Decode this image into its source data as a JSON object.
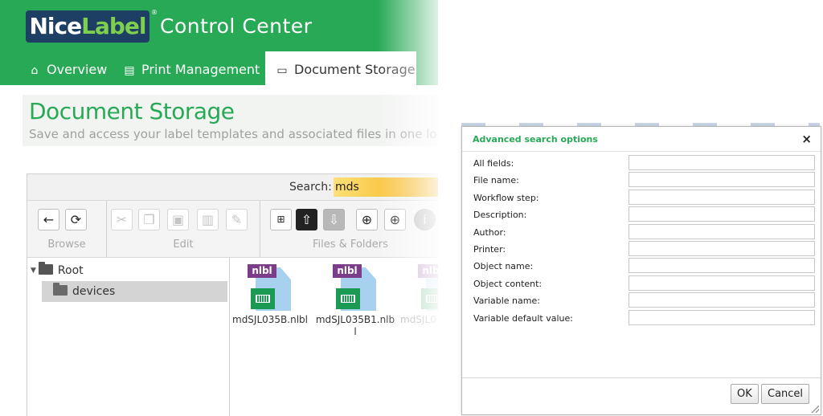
{
  "app": {
    "brand_part1": "Nice",
    "brand_part2": "Label",
    "brand_mark": "®",
    "name": "Control Center",
    "brand_colors": {
      "green": "#27a955",
      "navy": "#1c3f63"
    }
  },
  "nav": {
    "tabs": [
      {
        "label": "Overview",
        "icon": "home-icon"
      },
      {
        "label": "Print Management",
        "icon": "printer-icon"
      },
      {
        "label": "Document Storage",
        "icon": "inbox-icon",
        "active": true
      }
    ]
  },
  "page": {
    "title": "Document Storage",
    "subtitle": "Save and access your label templates and associated files in one lo"
  },
  "search": {
    "label": "Search:",
    "value": "mds"
  },
  "toolbar": {
    "groups": [
      {
        "caption": "Browse",
        "buttons": [
          "back-icon",
          "refresh-icon"
        ]
      },
      {
        "caption": "Edit",
        "buttons": [
          "cut-icon",
          "copy-icon",
          "paste-icon",
          "delete-icon",
          "edit-icon"
        ]
      },
      {
        "caption": "Files & Folders",
        "buttons": [
          "network-icon",
          "upload-icon",
          "download-icon",
          "new-folder-icon",
          "new-file-icon",
          "info-icon"
        ]
      }
    ]
  },
  "tree": {
    "root": "Root",
    "devices": "devices"
  },
  "files": [
    {
      "badge": "nlbl",
      "name": "mdSJL035B.nlbl"
    },
    {
      "badge": "nlbl",
      "name": "mdSJL035B1.nlbl"
    },
    {
      "badge": "nlbl",
      "name": "mdSJL0"
    }
  ],
  "dialog": {
    "title": "Advanced search options",
    "close": "×",
    "fields": [
      {
        "label": "All fields:",
        "value": ""
      },
      {
        "label": "File name:",
        "value": ""
      },
      {
        "label": "Workflow step:",
        "value": ""
      },
      {
        "label": "Description:",
        "value": ""
      },
      {
        "label": "Author:",
        "value": ""
      },
      {
        "label": "Printer:",
        "value": ""
      },
      {
        "label": "Object name:",
        "value": ""
      },
      {
        "label": "Object content:",
        "value": ""
      },
      {
        "label": "Variable name:",
        "value": ""
      },
      {
        "label": "Variable default value:",
        "value": ""
      }
    ],
    "ok_label": "OK",
    "cancel_label": "Cancel"
  }
}
